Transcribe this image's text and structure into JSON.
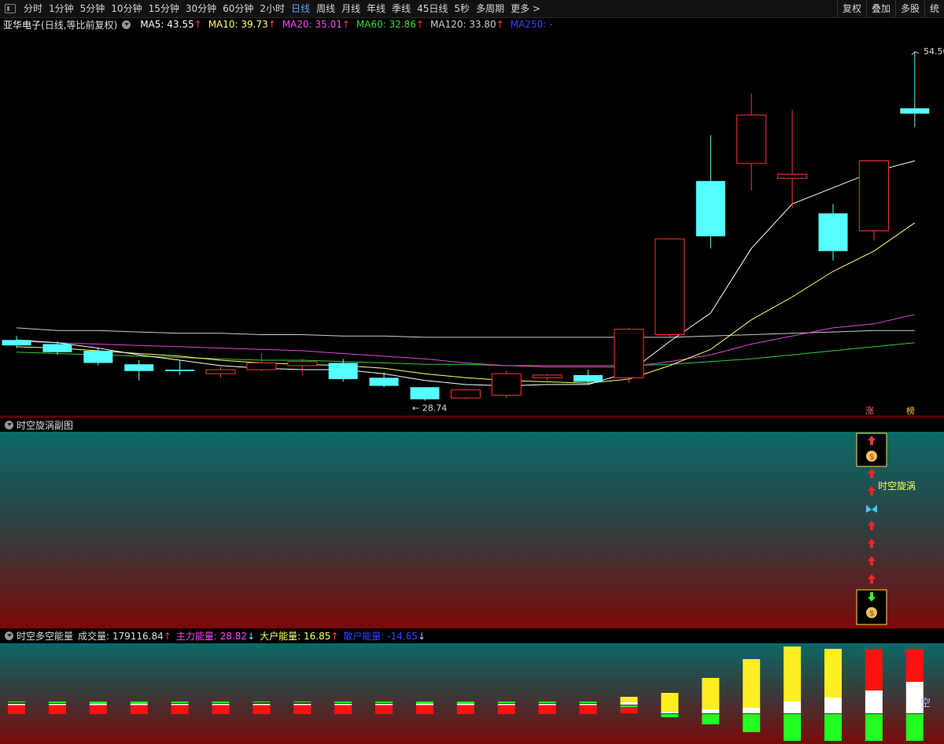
{
  "toolbar": {
    "periods": [
      "分时",
      "1分钟",
      "5分钟",
      "10分钟",
      "15分钟",
      "30分钟",
      "60分钟",
      "2小时",
      "日线",
      "周线",
      "月线",
      "年线",
      "季线",
      "45日线",
      "5秒",
      "多周期",
      "更多 >"
    ],
    "active_index": 8,
    "right": [
      "复权",
      "叠加",
      "多股",
      "统"
    ]
  },
  "header": {
    "stock": "亚华电子",
    "mode": "(日线,等比前复权)",
    "ma": [
      {
        "label": "MA5: 43.55",
        "arrow": "↑",
        "color": "#ffffff"
      },
      {
        "label": "MA10: 39.73",
        "arrow": "↑",
        "color": "#ffff66"
      },
      {
        "label": "MA20: 35.01",
        "arrow": "↑",
        "color": "#ff44ff"
      },
      {
        "label": "MA60: 32.86",
        "arrow": "↑",
        "color": "#33dd33"
      },
      {
        "label": "MA120: 33.80",
        "arrow": "↑",
        "color": "#cccccc"
      },
      {
        "label": "MA250: -",
        "arrow": "",
        "color": "#3344ff"
      }
    ]
  },
  "price": {
    "high_label": "54.50",
    "low_label": "28.74",
    "tag_zhang": "涨",
    "tag_bang": "榜"
  },
  "panel2": {
    "title": "时空旋涡副图",
    "label": "时空旋涡"
  },
  "panel3": {
    "title": "时空多空能量",
    "items": [
      {
        "label": "成交量: 179116.84",
        "arrow": "↑",
        "color": "#dddddd",
        "arrow_color": "#ff3b3b"
      },
      {
        "label": "主力能量: 28.82",
        "arrow": "↓",
        "color": "#ff44ff",
        "arrow_color": "#9cf"
      },
      {
        "label": "大户能量: 16.85",
        "arrow": "↑",
        "color": "#ffff66",
        "arrow_color": "#ff3b3b"
      },
      {
        "label": "散户能量: -14.65",
        "arrow": "↓",
        "color": "#3344ff",
        "arrow_color": "#9cf"
      }
    ],
    "corner": "空"
  },
  "chart_data": {
    "type": "candlestick",
    "candles": [
      {
        "o": 33.1,
        "c": 32.7,
        "h": 33.4,
        "l": 32.5
      },
      {
        "o": 32.8,
        "c": 32.2,
        "h": 33.0,
        "l": 32.0
      },
      {
        "o": 32.3,
        "c": 31.4,
        "h": 32.5,
        "l": 31.2
      },
      {
        "o": 31.3,
        "c": 30.8,
        "h": 31.6,
        "l": 30.1
      },
      {
        "o": 30.9,
        "c": 30.8,
        "h": 31.6,
        "l": 30.5
      },
      {
        "o": 30.6,
        "c": 30.9,
        "h": 31.1,
        "l": 30.3
      },
      {
        "o": 30.9,
        "c": 31.4,
        "h": 32.1,
        "l": 30.8
      },
      {
        "o": 31.2,
        "c": 31.5,
        "h": 31.7,
        "l": 30.5
      },
      {
        "o": 31.4,
        "c": 30.2,
        "h": 31.7,
        "l": 30.0
      },
      {
        "o": 30.3,
        "c": 29.7,
        "h": 30.7,
        "l": 29.6
      },
      {
        "o": 29.6,
        "c": 28.7,
        "h": 29.6,
        "l": 28.6
      },
      {
        "o": 28.8,
        "c": 29.4,
        "h": 29.5,
        "l": 28.7
      },
      {
        "o": 29.0,
        "c": 30.6,
        "h": 30.8,
        "l": 28.8
      },
      {
        "o": 30.3,
        "c": 30.5,
        "h": 30.6,
        "l": 30.1
      },
      {
        "o": 30.5,
        "c": 30.0,
        "h": 30.9,
        "l": 29.9
      },
      {
        "o": 30.3,
        "c": 33.9,
        "h": 34.0,
        "l": 29.9
      },
      {
        "o": 33.5,
        "c": 40.6,
        "h": 40.6,
        "l": 33.3
      },
      {
        "o": 44.9,
        "c": 40.8,
        "h": 48.3,
        "l": 39.9
      },
      {
        "o": 46.2,
        "c": 49.8,
        "h": 51.4,
        "l": 44.2
      },
      {
        "o": 45.1,
        "c": 45.4,
        "h": 50.2,
        "l": 42.9
      },
      {
        "o": 42.5,
        "c": 39.7,
        "h": 43.2,
        "l": 39.0
      },
      {
        "o": 41.2,
        "c": 46.4,
        "h": 46.4,
        "l": 40.5
      },
      {
        "o": 50.3,
        "c": 49.9,
        "h": 54.5,
        "l": 48.9
      }
    ],
    "ma5": [
      33.1,
      32.9,
      32.5,
      32.0,
      31.6,
      31.2,
      31.0,
      30.9,
      30.9,
      30.6,
      30.1,
      29.8,
      29.7,
      29.8,
      29.8,
      30.7,
      33.0,
      35.1,
      39.9,
      43.2,
      44.4,
      45.6,
      46.4
    ],
    "ma10": [
      32.6,
      32.5,
      32.3,
      32.1,
      31.9,
      31.6,
      31.4,
      31.3,
      31.2,
      31.0,
      30.6,
      30.3,
      30.1,
      30.0,
      29.9,
      30.2,
      31.2,
      32.4,
      34.6,
      36.3,
      38.2,
      39.7,
      41.8
    ],
    "ma20": [
      33.0,
      32.9,
      32.8,
      32.7,
      32.6,
      32.5,
      32.4,
      32.3,
      32.1,
      31.9,
      31.7,
      31.4,
      31.2,
      31.1,
      31.1,
      31.1,
      31.5,
      32.0,
      32.8,
      33.4,
      34.0,
      34.3,
      35.0
    ],
    "ma60": [
      32.2,
      32.1,
      32.0,
      31.9,
      31.8,
      31.7,
      31.6,
      31.6,
      31.5,
      31.4,
      31.3,
      31.3,
      31.2,
      31.2,
      31.2,
      31.2,
      31.3,
      31.5,
      31.7,
      32.0,
      32.3,
      32.6,
      32.9
    ],
    "ma120": [
      34.0,
      33.8,
      33.8,
      33.7,
      33.6,
      33.6,
      33.5,
      33.5,
      33.4,
      33.4,
      33.3,
      33.3,
      33.3,
      33.3,
      33.3,
      33.3,
      33.3,
      33.4,
      33.5,
      33.6,
      33.7,
      33.8,
      33.8
    ],
    "energy": [
      {
        "y": 2,
        "r": 8,
        "g": 0,
        "w": 1
      },
      {
        "y": 1,
        "r": 8,
        "g": 2,
        "w": 1
      },
      {
        "y": 1,
        "r": 8,
        "g": 3,
        "w": 1
      },
      {
        "y": 0,
        "r": 8,
        "g": 3,
        "w": 1
      },
      {
        "y": 1,
        "r": 8,
        "g": 2,
        "w": 1
      },
      {
        "y": 1,
        "r": 8,
        "g": 2,
        "w": 1
      },
      {
        "y": 1,
        "r": 8,
        "g": 1,
        "w": 1
      },
      {
        "y": 1,
        "r": 8,
        "g": 1,
        "w": 1
      },
      {
        "y": 1,
        "r": 8,
        "g": 2,
        "w": 1
      },
      {
        "y": 1,
        "r": 8,
        "g": 2,
        "w": 1
      },
      {
        "y": 1,
        "r": 8,
        "g": 3,
        "w": 1
      },
      {
        "y": 1,
        "r": 8,
        "g": 3,
        "w": 1
      },
      {
        "y": 1,
        "r": 8,
        "g": 2,
        "w": 1
      },
      {
        "y": 1,
        "r": 8,
        "g": 2,
        "w": 2
      },
      {
        "y": 1,
        "r": 8,
        "g": 2,
        "w": 2
      },
      {
        "y": 7,
        "r": 6,
        "g": 0,
        "w": 3
      },
      {
        "y": 24,
        "r": 0,
        "g": -4,
        "w": 2
      },
      {
        "y": 40,
        "r": 0,
        "g": -13,
        "w": 5
      },
      {
        "y": 62,
        "r": 0,
        "g": -23,
        "w": 7
      },
      {
        "y": 70,
        "r": 0,
        "g": -34,
        "w": 15
      },
      {
        "y": 62,
        "r": 0,
        "g": -34,
        "w": 20
      },
      {
        "y": 0,
        "r": 47,
        "g": -34,
        "w": 29
      },
      {
        "y": 0,
        "r": 44,
        "g": -34,
        "w": 40
      }
    ],
    "ylim": [
      27.4,
      56.0
    ]
  }
}
